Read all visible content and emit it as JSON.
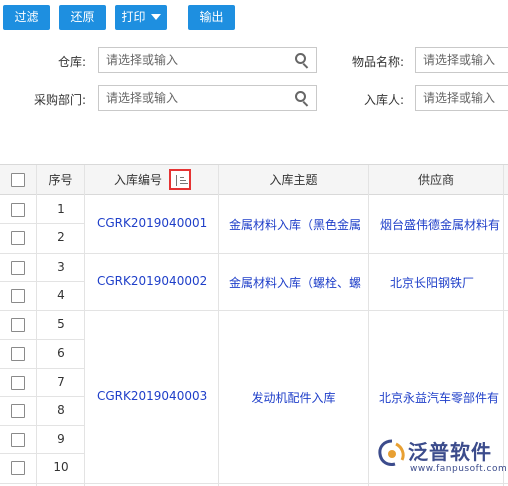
{
  "toolbar": {
    "filter_label": "过滤",
    "reset_label": "还原",
    "print_label": "打印",
    "export_label": "输出"
  },
  "filters": {
    "warehouse_label": "仓库:",
    "item_name_label": "物品名称:",
    "dept_label": "采购部门:",
    "receiver_label": "入库人:",
    "placeholder": "请选择或输入"
  },
  "grid": {
    "headers": {
      "seq": "序号",
      "code": "入库编号",
      "subject": "入库主题",
      "supplier": "供应商"
    },
    "seq_numbers": [
      "1",
      "2",
      "3",
      "4",
      "5",
      "6",
      "7",
      "8",
      "9",
      "10"
    ],
    "groups": [
      {
        "code": "CGRK2019040001",
        "subject": "金属材料入库（黑色金属",
        "supplier": "烟台盛伟德金属材料有"
      },
      {
        "code": "CGRK2019040002",
        "subject": "金属材料入库（螺栓、螺",
        "supplier": "北京长阳钢铁厂"
      },
      {
        "code": "CGRK2019040003",
        "subject": "发动机配件入库",
        "supplier": "北京永益汽车零部件有"
      }
    ]
  },
  "watermark": {
    "brand": "泛普软件",
    "url": "www.fanpusoft.com",
    "colors": {
      "brand": "#3c4c8c",
      "accent": "#e8a033"
    }
  },
  "colors": {
    "button": "#1e8fe0",
    "link": "#1f3fc9",
    "sort_highlight": "#e53333"
  }
}
